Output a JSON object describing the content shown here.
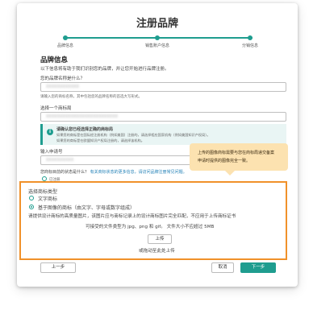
{
  "header": {
    "title": "注册品牌"
  },
  "steps": [
    {
      "label": "品牌信息"
    },
    {
      "label": "销售账户信息"
    },
    {
      "label": "分销信息"
    }
  ],
  "brand_info": {
    "heading": "品牌信息",
    "intro": "以下信息将有助于我们识别您的品牌，并让您开始进行品牌注册。",
    "brand_name_label": "您的品牌名称是什么？",
    "brand_name_value": "XXXXXXXXXXXX",
    "brand_name_hint": "请输入您的商标名称，其中包括您的品牌名称的首选大写形式。",
    "trademark_office_label": "选择一个商标局",
    "trademark_office_value": "XXXXXXXXXXXXXXXXXXXXXXXXXX"
  },
  "notice": {
    "title": "请确认您已经选择正确的商标局",
    "line1": "如果您的商标是在国际经注册机构（例如美国）注册的，请选择相应国家机构（例如美国知识产权局）。",
    "line2": "如果您的商标是在欧盟知识产权局注册的，请选择该机构。"
  },
  "application": {
    "label": "输入申请号",
    "value": "XXXXXXXXXX",
    "status_question": "您商标目前的状态是什么？",
    "status_link": "有关商标状态的更多信息，请访问品牌注册常见问题。",
    "checkbox_label": "已注册"
  },
  "tooltip": {
    "line1": "上传的图像商标需要与您在商标局递交备案",
    "line2": "申请时提供的图像完全一致。"
  },
  "trademark_type": {
    "label": "选择商标类型",
    "option_text": "文字商标",
    "option_image": "基于图像的商标（由文字、字母或数字组成）",
    "upload_instruction": "请提供设计商标的高质量图片，该图片应与商标记录上的设计商标图片完全匹配，不应用于上传商标证书",
    "file_types": "可接受的文件类型为 jpg、png 和 gif。  文件大小不应超过 5MB",
    "upload_button": "上传",
    "drag_text": "或拖动至此处上传"
  },
  "footer": {
    "prev_button": "上一步",
    "cancel_button": "取消",
    "next_button": "下一步"
  },
  "colors": {
    "accent": "#1f9d8f",
    "highlight": "#f0912a",
    "tooltip_bg": "#fce2b0"
  }
}
